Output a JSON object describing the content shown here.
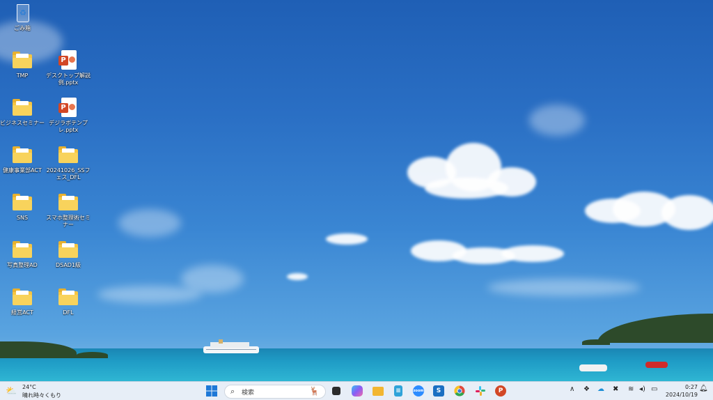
{
  "desktop_icons": [
    {
      "label": "ごみ箱",
      "type": "recycle-bin"
    },
    {
      "label": "TMP",
      "type": "folder"
    },
    {
      "label": "デスクトップ解説例.pptx",
      "type": "pptx"
    },
    {
      "label": "ビジネスセミナー",
      "type": "folder"
    },
    {
      "label": "デジラボテンプレ.pptx",
      "type": "pptx"
    },
    {
      "label": "健康事業部ACT",
      "type": "folder"
    },
    {
      "label": "20241026_SSフェス_DFL",
      "type": "folder"
    },
    {
      "label": "SNS",
      "type": "folder"
    },
    {
      "label": "スマホ整理術セミナー",
      "type": "folder"
    },
    {
      "label": "写真整理AD",
      "type": "folder"
    },
    {
      "label": "DSAD1級",
      "type": "folder"
    },
    {
      "label": "経営ACT",
      "type": "folder"
    },
    {
      "label": "DFL",
      "type": "folder"
    }
  ],
  "taskbar": {
    "weather": {
      "temp": "24°C",
      "condition": "晴れ時々くもり",
      "icon": "partly-cloudy-icon"
    },
    "search_placeholder": "検索",
    "apps": [
      {
        "name": "start-button",
        "icon": "windows-logo-icon",
        "color": "#1e78d7"
      },
      {
        "name": "task-view-button",
        "icon": "task-view-icon",
        "color": "#333333"
      },
      {
        "name": "copilot-button",
        "icon": "copilot-icon",
        "color": "#8a5cf5"
      },
      {
        "name": "file-explorer-button",
        "icon": "folder-icon",
        "color": "#f2b632"
      },
      {
        "name": "notepad-button",
        "icon": "notepad-icon",
        "color": "#2fa3d9"
      },
      {
        "name": "zoom-button",
        "icon": "zoom-icon",
        "color": "#2d8cff"
      },
      {
        "name": "app-s-button",
        "icon": "app-s-icon",
        "color": "#1b6fc2"
      },
      {
        "name": "chrome-button",
        "icon": "chrome-icon",
        "color": "#e24a3b"
      },
      {
        "name": "slack-button",
        "icon": "slack-icon",
        "color": "#4a154b"
      },
      {
        "name": "powerpoint-button",
        "icon": "powerpoint-icon",
        "color": "#d24726"
      }
    ],
    "tray_icons": [
      "chevron-up-icon",
      "dropbox-icon",
      "onedrive-icon",
      "x-app-icon",
      "wifi-icon",
      "speaker-icon",
      "battery-icon"
    ],
    "time": "0:27",
    "date": "2024/10/19",
    "notification_icon": "bell-icon"
  }
}
